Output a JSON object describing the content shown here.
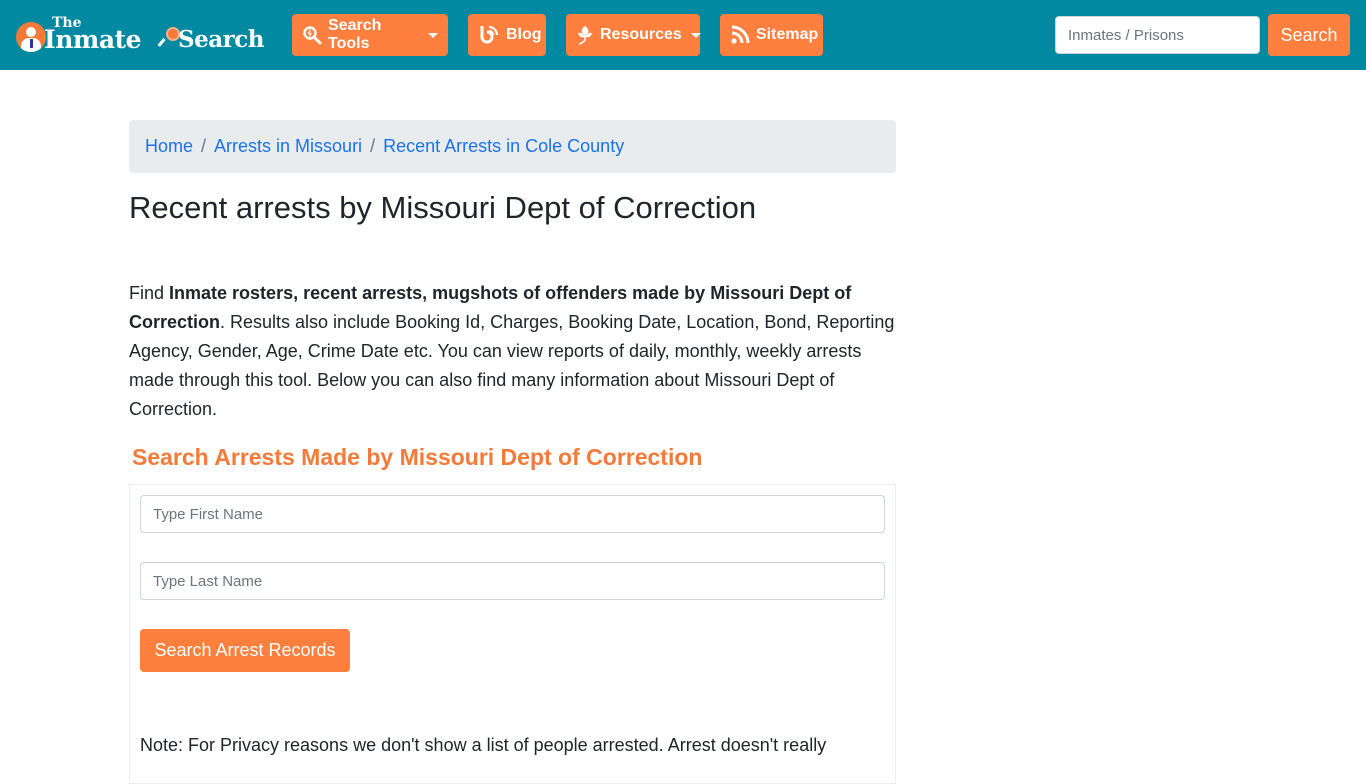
{
  "navbar": {
    "logo": {
      "the": "The",
      "inmate": "Inmate",
      "search": "Search"
    },
    "items": [
      {
        "label": "Search Tools",
        "icon": "search-tools-icon",
        "dropdown": true
      },
      {
        "label": "Blog",
        "icon": "blog-icon",
        "dropdown": false
      },
      {
        "label": "Resources",
        "icon": "leaf-icon",
        "dropdown": true
      },
      {
        "label": "Sitemap",
        "icon": "rss-icon",
        "dropdown": false
      }
    ],
    "search": {
      "placeholder": "Inmates / Prisons",
      "value": "",
      "button_label": "Search"
    }
  },
  "colors": {
    "navbar_bg": "#0089a0",
    "accent": "#ff7f3f",
    "heading_orange": "#f47a3a",
    "link": "#1a73e8",
    "breadcrumb_bg": "#e9ecef"
  },
  "breadcrumb": [
    {
      "label": "Home"
    },
    {
      "label": "Arrests in Missouri"
    },
    {
      "label": "Recent Arrests in Cole County"
    }
  ],
  "main": {
    "title": "Recent arrests by Missouri Dept of Correction",
    "intro": {
      "prefix": "Find ",
      "bold": "Inmate rosters, recent arrests, mugshots of offenders made by Missouri Dept of Correction",
      "rest": ". Results also include Booking Id, Charges, Booking Date, Location, Bond, Reporting Agency, Gender, Age, Crime Date etc. You can view reports of daily, monthly, weekly arrests made through this tool. Below you can also find many information about Missouri Dept of Correction."
    },
    "search_form": {
      "heading": "Search Arrests Made by Missouri Dept of Correction",
      "first_name": {
        "placeholder": "Type First Name",
        "value": ""
      },
      "last_name": {
        "placeholder": "Type Last Name",
        "value": ""
      },
      "submit_label": "Search Arrest Records",
      "note": "Note: For Privacy reasons we don't show a list of people arrested. Arrest doesn't really"
    }
  }
}
